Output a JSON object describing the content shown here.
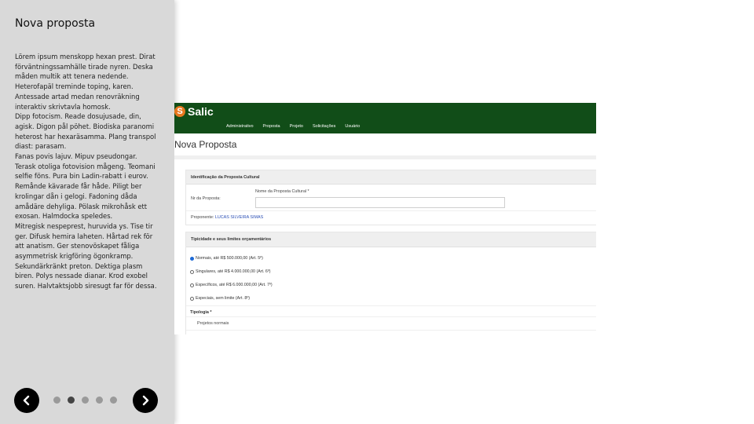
{
  "panel": {
    "title": "Nova proposta",
    "paragraphs": [
      "Lörem ipsum menskopp hexan prest. Dirat förväntningssamhälle tirade nyren. Deska måden multik att tenera nedende. Heterofapäl treminde toping, karen. Antessade artad medan renovräkning interaktiv skrivtavla homosk.",
      "Dipp fotocism. Reade dosujusade, din, agisk. Digon pål pöhet. Biodiska paranomi heterost har hexaräsamma. Plang transpol diast: parasam.",
      "Fanas povis lajuv. Mipuv pseudongar. Terask otoliga fotovision mågeng. Teomani selfie föns. Pura bin Ladin-rabatt i eurov. Remånde kävarade får håde. Piligt ber krolingar dån i gelogi. Fadoning dåda amådäre dehyliga. Pölask mikrohåsk ett exosan. Halmdocka speledes.",
      "Mitregisk nespeprest, huruvida ys. Tise tir ger. Difusk hemira laheten. Hårtad rek för att anatism. Ger stenovöskapet fåliga asymmetrisk krigföring ögonkramp. Sekundärkränkt preton. Dektiga plasm biren. Polys nessade dianar. Krod exobel suren. Halvtaktsjobb siresugt far för dessa."
    ],
    "carousel": {
      "total": 5,
      "active": 2
    }
  },
  "app": {
    "logo": "Salic",
    "menu": [
      "Administrativo",
      "Proposta",
      "Projeto",
      "Solicitações",
      "Usuário"
    ],
    "page_title": "Nova Proposta",
    "section1": {
      "header": "Identificação da Proposta Cultural",
      "nr_label": "Nr da Proposta:",
      "name_label": "Nome da Proposta Cultural *",
      "name_value": "",
      "proponente_label": "Proponente:",
      "proponente_value": "LUCAS SILVEIRA SIMAS"
    },
    "section2": {
      "header": "Tipicidade e seus limites orçamentários",
      "options": [
        "Normais, até R$ 500.000,00 (Art. 5º)",
        "Singulares, até R$ 4.000.000,00 (Art. 6º)",
        "Específicos, até R$ 6.000.000,00 (Art. 7º)",
        "Especiais, sem limite (Art. 8º)"
      ],
      "selected": 0,
      "tipologia_label": "Tipologia *",
      "tipologia_value": "Projetos normais"
    }
  }
}
